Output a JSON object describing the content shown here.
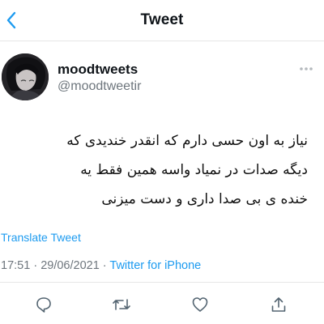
{
  "header": {
    "title": "Tweet",
    "back_icon": "back-chevron-icon",
    "accent_color": "#1d9bf0"
  },
  "author": {
    "display_name": "moodtweets",
    "handle": "@moodtweetir"
  },
  "tweet": {
    "lines": "نیاز به اون حسی دارم که انقدر خندیدی  که\nدیگه صدات در نمیاد واسه همین فقط یه\nخنده ی بی صدا داری و دست میزنی",
    "translate_label": "Translate Tweet",
    "time": "17:51",
    "date": "29/06/2021",
    "separator": " · ",
    "source": "Twitter for iPhone"
  },
  "actions": [
    {
      "icon": "reply-icon"
    },
    {
      "icon": "retweet-icon"
    },
    {
      "icon": "like-icon"
    },
    {
      "icon": "share-icon"
    }
  ]
}
